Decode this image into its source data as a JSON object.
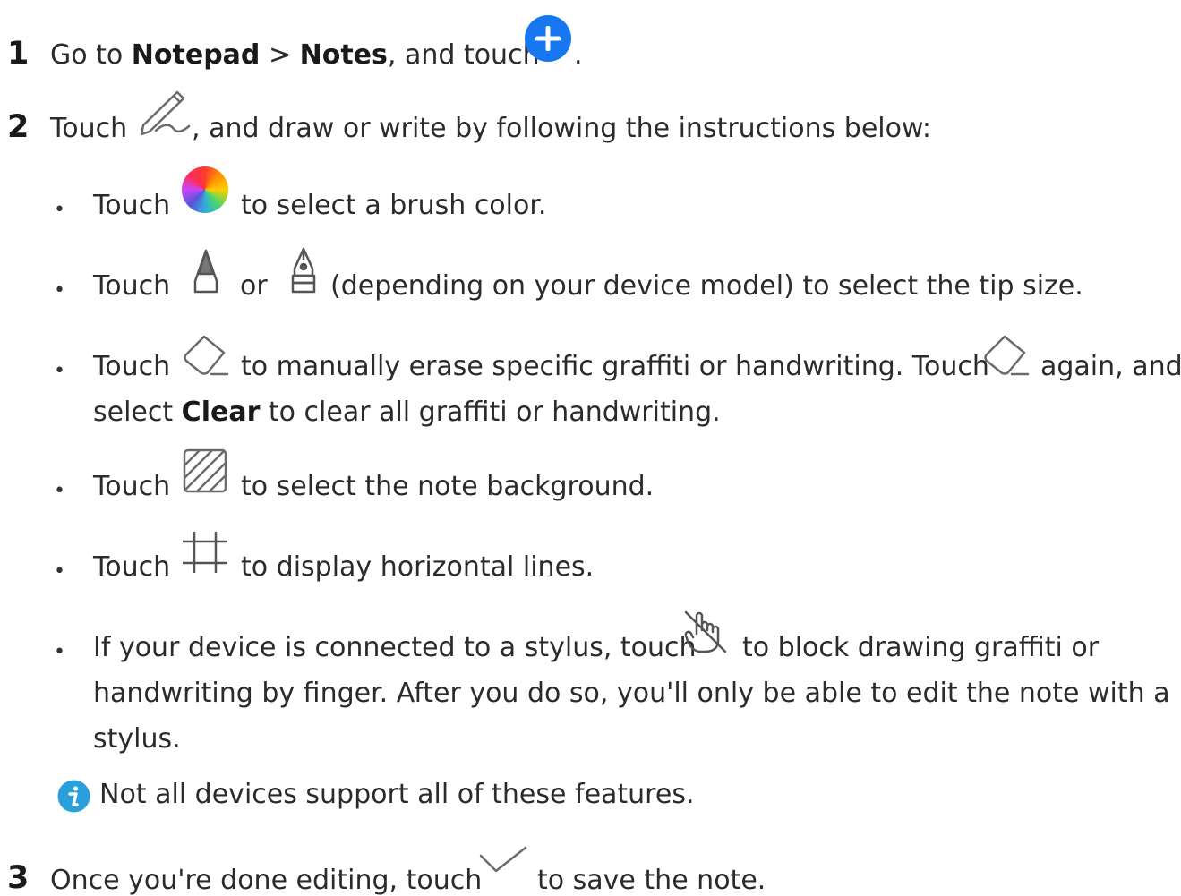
{
  "steps": [
    {
      "number": "1",
      "parts": {
        "a": "Go to ",
        "notepad": "Notepad",
        "sep": " > ",
        "notes": "Notes",
        "b": ", and touch",
        "end": "."
      }
    },
    {
      "number": "2",
      "parts": {
        "a": "Touch",
        "b": ", and draw or write by following the instructions below:"
      }
    },
    {
      "number": "3",
      "parts": {
        "a": "Once you're done editing, touch",
        "b": "to save the note."
      }
    }
  ],
  "bullets": {
    "color": {
      "a": "Touch",
      "b": "to select a brush color."
    },
    "tip": {
      "a": "Touch",
      "or": "or",
      "b": "(depending on your device model) to select the tip size."
    },
    "eraser": {
      "a": "Touch",
      "b": "to manually erase specific graffiti or handwriting. Touch",
      "c": "again, and",
      "d": "select ",
      "clear": "Clear",
      "e": " to clear all graffiti or handwriting."
    },
    "background": {
      "a": "Touch",
      "b": "to select the note background."
    },
    "lines": {
      "a": "Touch",
      "b": "to display horizontal lines."
    },
    "stylus": {
      "a": "If your device is connected to a stylus, touch",
      "b": "to block drawing graffiti or",
      "c": "handwriting by finger. After you do so, you'll only be able to edit the note with a",
      "d": "stylus."
    }
  },
  "note": {
    "text": "Not all devices support all of these features."
  },
  "colors": {
    "accent": "#1677f0",
    "info": "#29a0dc",
    "icon": "#6b6b6b"
  },
  "icons": [
    "add-icon",
    "pen-icon",
    "color-wheel-icon",
    "pen-tip-icon",
    "fountain-pen-icon",
    "eraser-icon",
    "background-pattern-icon",
    "crop-lines-icon",
    "finger-block-icon",
    "info-icon",
    "checkmark-icon"
  ]
}
